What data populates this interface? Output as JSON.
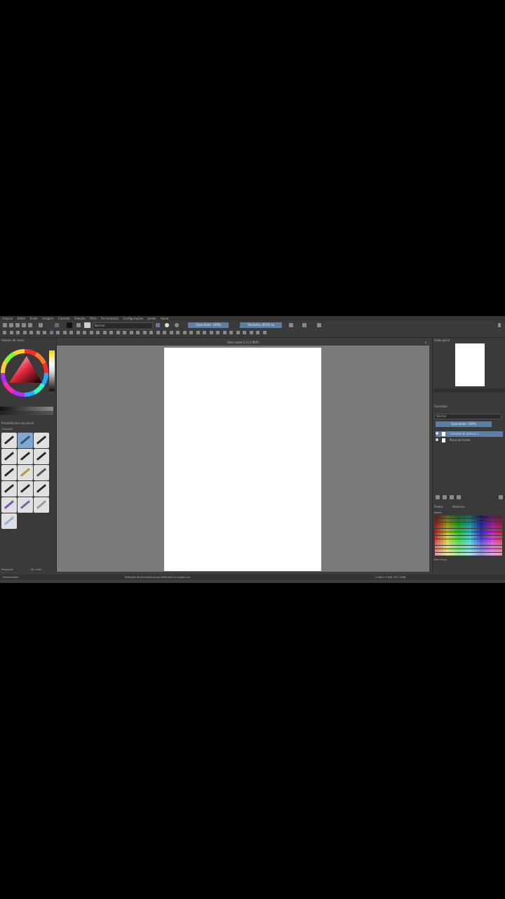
{
  "menubar": {
    "items": [
      "Arquivo",
      "Editar",
      "Exibir",
      "Imagem",
      "Camada",
      "Seleção",
      "Filtro",
      "Ferramentas",
      "Configurações",
      "Janela",
      "Ajuda"
    ]
  },
  "toolbar": {
    "blend_mode": "Normal",
    "opacity_label": "Opacidade: 100%",
    "size_label": "Tamanho: 40,00 px"
  },
  "left_panel": {
    "color_selector_title": "Seletor de cores",
    "brush_presets_title": "Predefinições de pincel",
    "tag_label": "Etiqueta",
    "brush_count": 16,
    "footer_left": "Pesquisar",
    "footer_right": "Ver mais"
  },
  "canvas": {
    "document_tab": "Sem nome 1 (1,0 MiB)"
  },
  "right_panel": {
    "overview_title": "Visão geral",
    "layers_title": "Camadas",
    "blend_mode": "Normal",
    "opacity_label": "Opacidade: 100%",
    "layers": [
      {
        "name": "Camada de pintura 1",
        "selected": true
      },
      {
        "name": "Plano de fundo",
        "selected": false
      }
    ],
    "palette_title": "Paleta",
    "palette_tabs": [
      "Paleta",
      "Histórico"
    ],
    "palette_footer": "Sem título"
  },
  "statusbar": {
    "left": "Ferramentas",
    "center": "RGB/Alfa (8-bit inteiro/canal) sRGB-elle-V2-srgbtrc.icc",
    "right": "2.480 x 3.508 (33,2 MiB)"
  },
  "colors": {
    "accent": "#5d7fa6",
    "panel_bg": "#3a3a3a",
    "canvas_bg": "#7a7a7a",
    "paper": "#ffffff"
  }
}
